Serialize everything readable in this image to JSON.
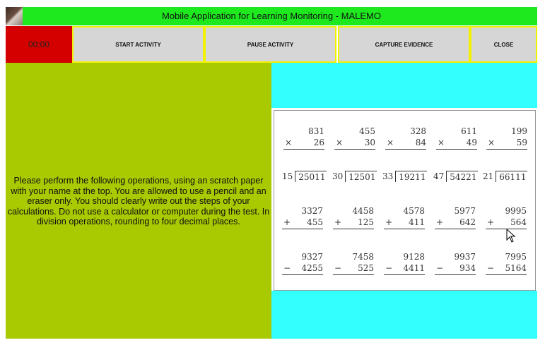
{
  "app": {
    "title": "Mobile Application for Learning Monitoring - MALEMO"
  },
  "toolbar": {
    "timer": "00:00",
    "start_label": "START ACTIVITY",
    "pause_label": "PAUSE ACTIVITY",
    "capture_label": "CAPTURE EVIDENCE",
    "close_label": "CLOSE",
    "colors": {
      "timer_bg": "#d40000",
      "button_bg": "#d6d6d6",
      "button_border": "#f2f200"
    }
  },
  "instructions": "Please perform the following operations, using an scratch paper with your name at the top. You are allowed to use a pencil and an eraser only. You should clearly write out the steps of your calculations. Do not use a calculator or computer during the test. In division operations, rounding to four decimal places.",
  "colors": {
    "title_bar": "#1ee81e",
    "left_panel": "#a9c900",
    "right_panel": "#33ffff"
  },
  "exercises": {
    "multiplication": [
      {
        "a": "831",
        "b": "26",
        "op": "×"
      },
      {
        "a": "455",
        "b": "30",
        "op": "×"
      },
      {
        "a": "328",
        "b": "84",
        "op": "×"
      },
      {
        "a": "611",
        "b": "49",
        "op": "×"
      },
      {
        "a": "199",
        "b": "59",
        "op": "×"
      }
    ],
    "division": [
      {
        "divisor": "15",
        "dividend": "25011"
      },
      {
        "divisor": "30",
        "dividend": "12501"
      },
      {
        "divisor": "33",
        "dividend": "19211"
      },
      {
        "divisor": "47",
        "dividend": "54221"
      },
      {
        "divisor": "21",
        "dividend": "66111"
      }
    ],
    "addition": [
      {
        "a": "3327",
        "b": "455",
        "op": "+"
      },
      {
        "a": "4458",
        "b": "125",
        "op": "+"
      },
      {
        "a": "4578",
        "b": "411",
        "op": "+"
      },
      {
        "a": "5977",
        "b": "642",
        "op": "+"
      },
      {
        "a": "9995",
        "b": "564",
        "op": "+"
      }
    ],
    "subtraction": [
      {
        "a": "9327",
        "b": "4255",
        "op": "−"
      },
      {
        "a": "7458",
        "b": "525",
        "op": "−"
      },
      {
        "a": "9128",
        "b": "4411",
        "op": "−"
      },
      {
        "a": "9937",
        "b": "934",
        "op": "−"
      },
      {
        "a": "7995",
        "b": "5164",
        "op": "−"
      }
    ]
  },
  "cursor_icon": "mouse-pointer-icon"
}
